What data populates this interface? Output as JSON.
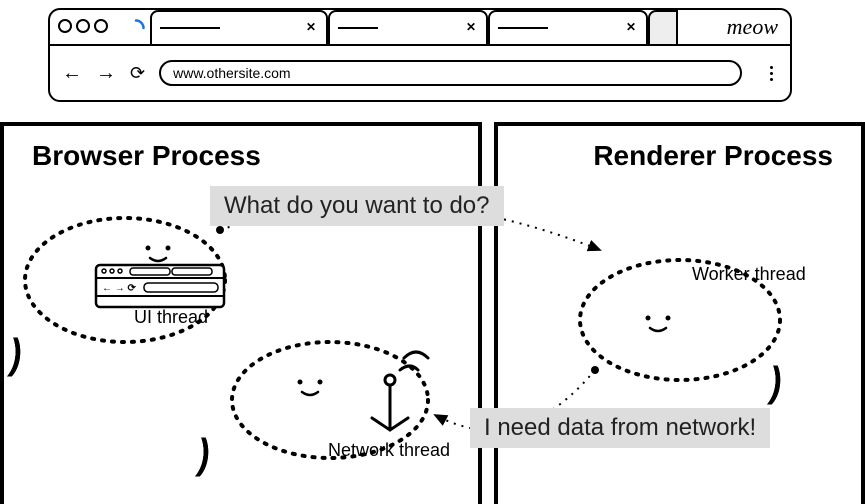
{
  "browser": {
    "url": "www.othersite.com",
    "meow": "meow"
  },
  "processes": {
    "browser_title": "Browser Process",
    "renderer_title": "Renderer Process"
  },
  "speech": {
    "q": "What do you want to do?",
    "a": "I need data from network!"
  },
  "threads": {
    "ui": "UI thread",
    "network": "Network thread",
    "worker": "Worker thread"
  }
}
